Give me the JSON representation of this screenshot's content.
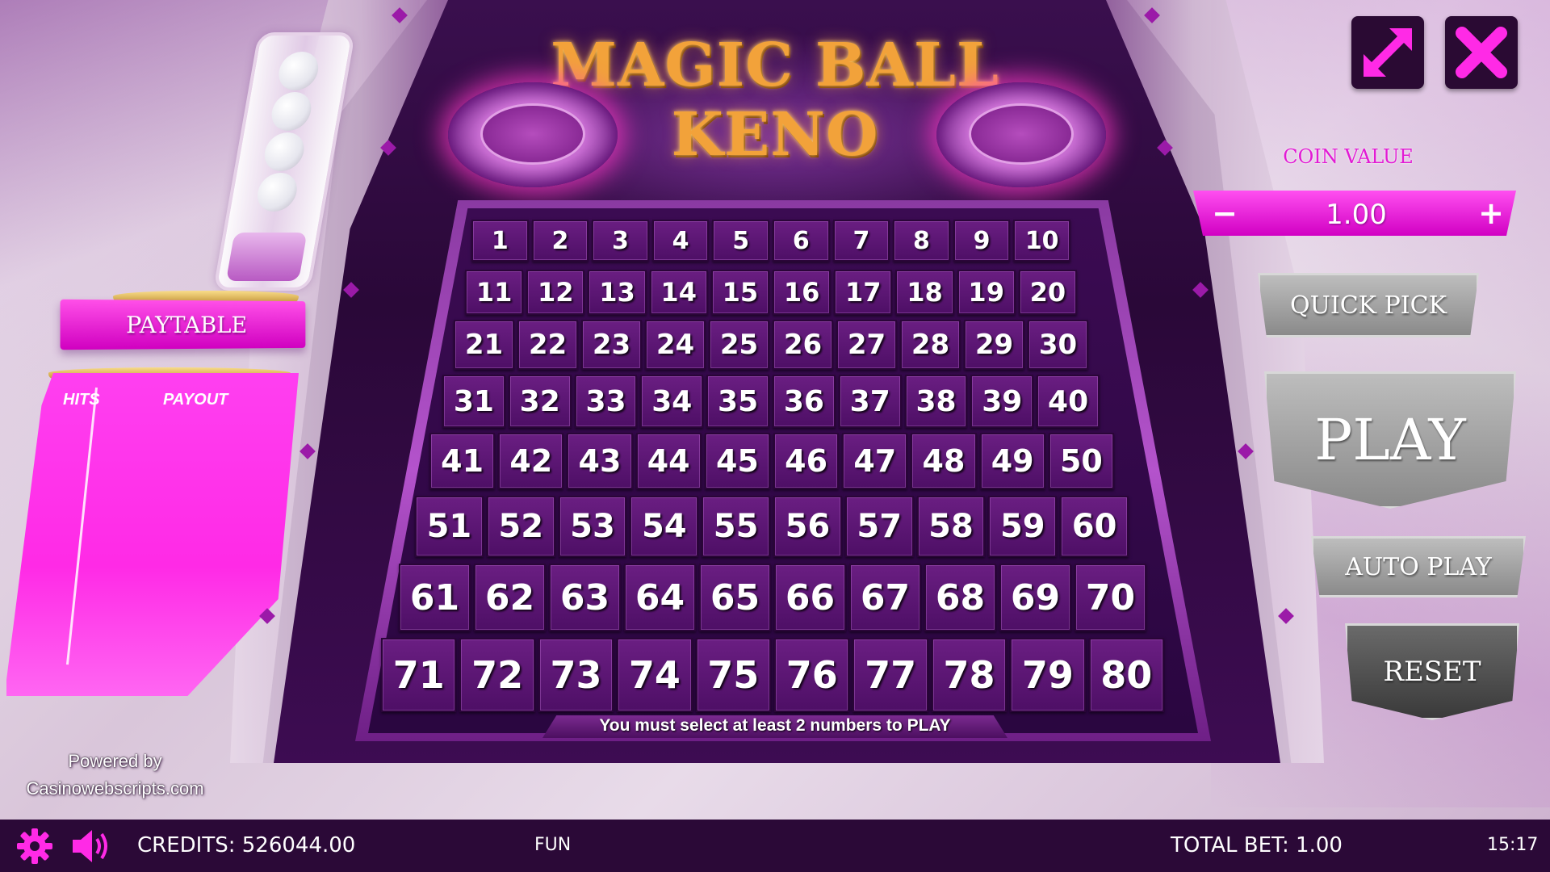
{
  "title": {
    "line1": "MAGIC BALL",
    "line2": "KENO"
  },
  "paytable": {
    "title": "PAYTABLE",
    "hits_header": "HITS",
    "payout_header": "PAYOUT"
  },
  "powered": {
    "line1": "Powered by",
    "line2": "Casinowebscripts.com"
  },
  "board": {
    "numbers": [
      1,
      2,
      3,
      4,
      5,
      6,
      7,
      8,
      9,
      10,
      11,
      12,
      13,
      14,
      15,
      16,
      17,
      18,
      19,
      20,
      21,
      22,
      23,
      24,
      25,
      26,
      27,
      28,
      29,
      30,
      31,
      32,
      33,
      34,
      35,
      36,
      37,
      38,
      39,
      40,
      41,
      42,
      43,
      44,
      45,
      46,
      47,
      48,
      49,
      50,
      51,
      52,
      53,
      54,
      55,
      56,
      57,
      58,
      59,
      60,
      61,
      62,
      63,
      64,
      65,
      66,
      67,
      68,
      69,
      70,
      71,
      72,
      73,
      74,
      75,
      76,
      77,
      78,
      79,
      80
    ],
    "notice": "You must select at least 2 numbers to PLAY"
  },
  "controls": {
    "coin_label": "COIN VALUE",
    "coin_value": "1.00",
    "coin_minus": "−",
    "coin_plus": "+",
    "quick_pick": "QUICK PICK",
    "play": "PLAY",
    "auto_play": "AUTO PLAY",
    "reset": "RESET",
    "fullscreen_icon": "fullscreen-icon",
    "close_icon": "close-icon"
  },
  "status": {
    "credits": "CREDITS: 526044.00",
    "mode": "FUN",
    "total_bet": "TOTAL BET: 1.00",
    "time": "15:17"
  },
  "colors": {
    "accent": "#ff2ae6",
    "machine": "#2a0838",
    "title": "#f2a23a",
    "bar": "#2b0937"
  }
}
